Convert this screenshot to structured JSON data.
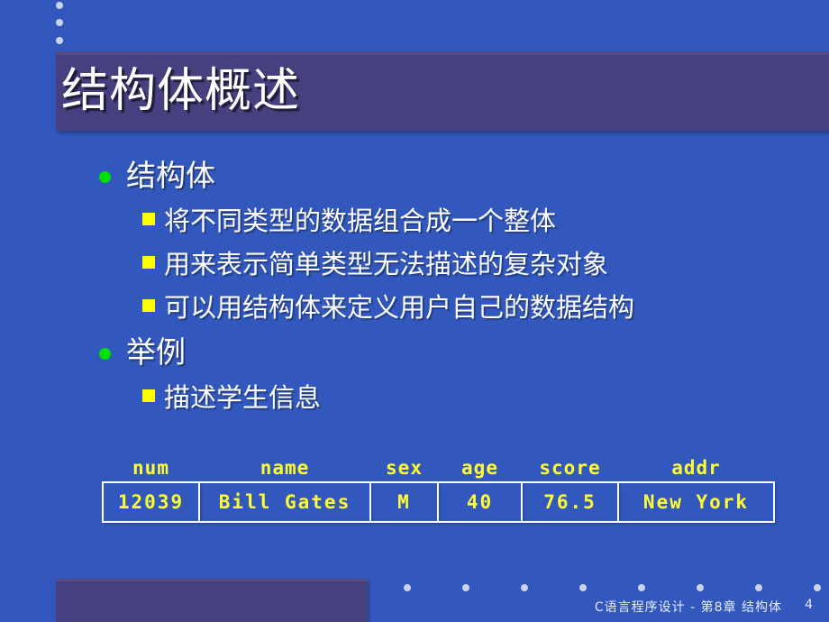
{
  "slide": {
    "title": "结构体概述",
    "background_color": "#3358bd",
    "band_color": "#46407f",
    "bullet_level1_color": "#00e000",
    "bullet_level2_color": "#ffff00",
    "table_text_color": "#ffff33",
    "table_border_color": "#ffffff"
  },
  "decor_dots": {
    "top_left_count": 3,
    "footer_count": 8
  },
  "content": {
    "sections": [
      {
        "heading": "结构体",
        "items": [
          "将不同类型的数据组合成一个整体",
          "用来表示简单类型无法描述的复杂对象",
          "可以用结构体来定义用户自己的数据结构"
        ]
      },
      {
        "heading": "举例",
        "items": [
          "描述学生信息"
        ]
      }
    ]
  },
  "table": {
    "headers": [
      "num",
      "name",
      "sex",
      "age",
      "score",
      "addr"
    ],
    "rows": [
      [
        "12039",
        "Bill Gates",
        "M",
        "40",
        "76.5",
        "New York"
      ]
    ]
  },
  "footer": {
    "caption": "C语言程序设计 - 第8章  结构体",
    "page_number": "4"
  }
}
